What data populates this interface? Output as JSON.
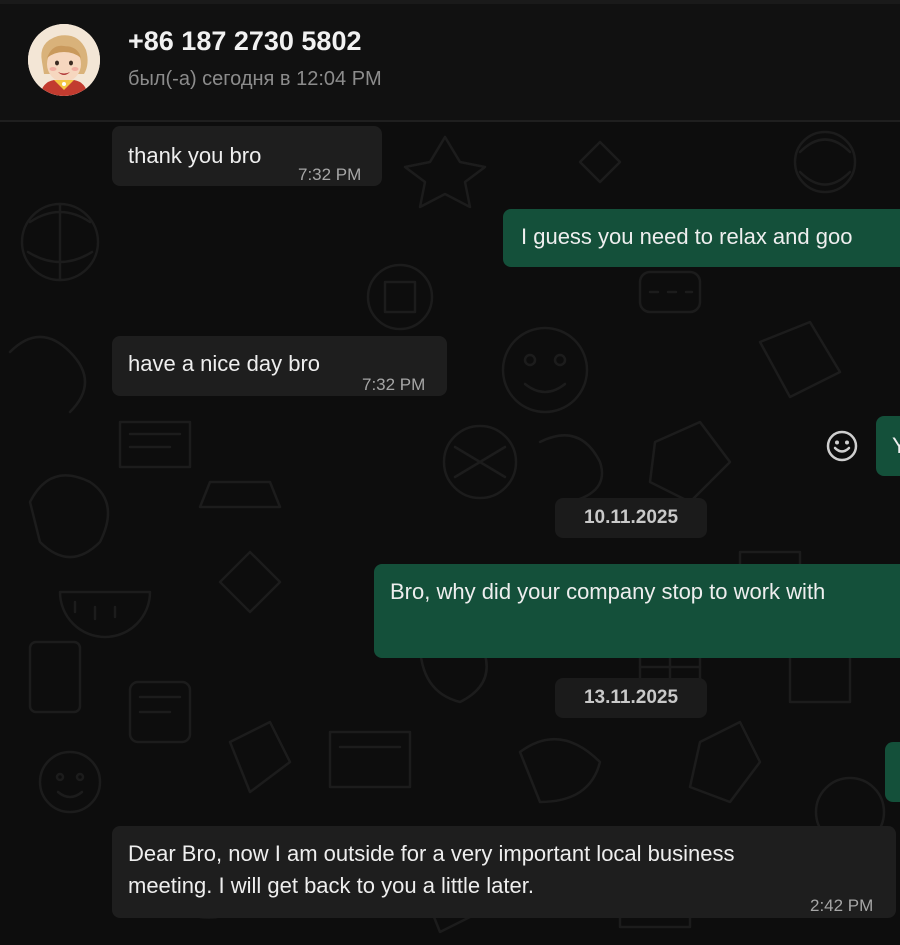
{
  "header": {
    "contact_name": "+86 187 2730 5802",
    "last_seen": "был(-а) сегодня в 12:04 PM"
  },
  "messages": [
    {
      "direction": "incoming",
      "text": "thank you bro",
      "time": "7:32 PM"
    },
    {
      "direction": "outgoing",
      "text": "I guess you need to relax and goo"
    },
    {
      "direction": "incoming",
      "text": "have a nice day bro",
      "time": "7:32 PM"
    },
    {
      "direction": "outgoing",
      "text": "Y"
    },
    {
      "direction": "outgoing",
      "text": "Bro, why did your company stop to work with"
    },
    {
      "direction": "outgoing",
      "text": ""
    },
    {
      "direction": "incoming",
      "text_line1": "Dear Bro, now I am outside for a very important local business",
      "text_line2": "meeting. I will get back to you a little later.",
      "time": "2:42 PM"
    }
  ],
  "dates": [
    "10.11.2025",
    "13.11.2025"
  ],
  "icons": {
    "react": "smiley-face-icon",
    "avatar": "contact-avatar"
  },
  "colors": {
    "background": "#0d0d0d",
    "incoming_bubble": "#1e1e1e",
    "outgoing_bubble": "#14503a",
    "header": "#111111"
  }
}
